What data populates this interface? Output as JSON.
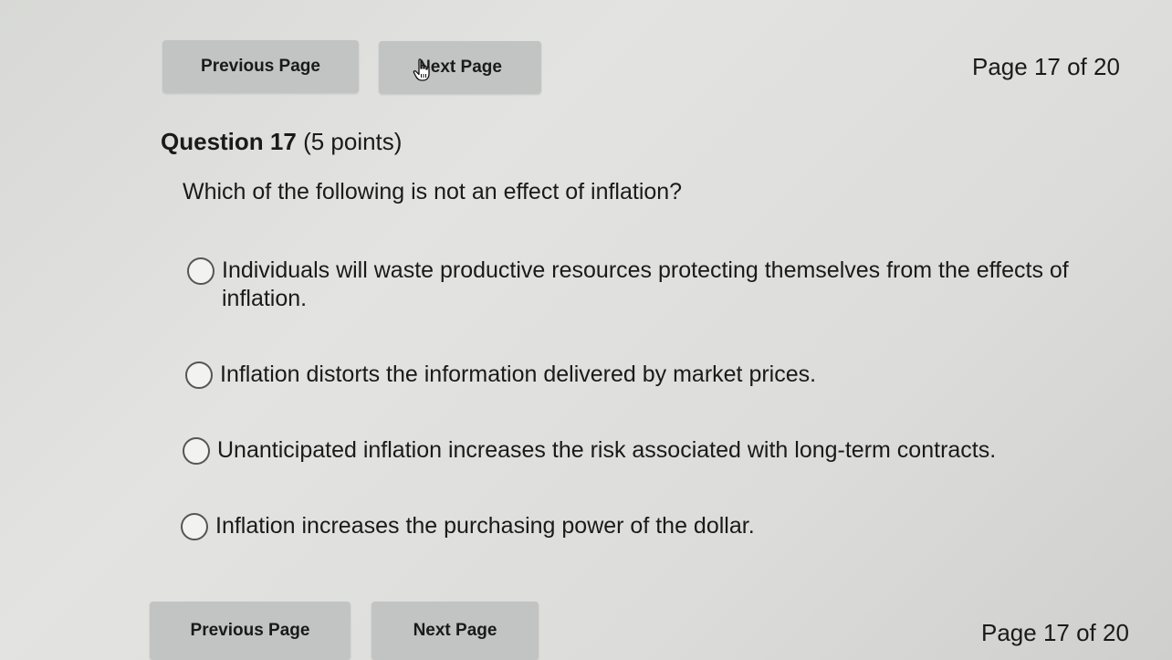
{
  "nav_top": {
    "previous_label": "Previous Page",
    "next_label": "Next Page",
    "page_indicator": "Page 17 of 20"
  },
  "question": {
    "number_label": "Question 17",
    "points_label": "(5 points)",
    "prompt": "Which of the following is not an effect of inflation?",
    "options": [
      {
        "label": "Individuals will waste productive resources protecting themselves from the effects of inflation.",
        "selected": false
      },
      {
        "label": "Inflation distorts the information delivered by market prices.",
        "selected": false
      },
      {
        "label": "Unanticipated inflation increases the risk associated with long-term contracts.",
        "selected": false
      },
      {
        "label": "Inflation increases the purchasing power of the dollar.",
        "selected": false
      }
    ]
  },
  "nav_bottom": {
    "previous_label": "Previous Page",
    "next_label": "Next Page",
    "page_indicator": "Page 17 of 20"
  },
  "colors": {
    "background": "#dcdcda",
    "button": "#c2c4c3",
    "text": "#1a1a1a"
  }
}
